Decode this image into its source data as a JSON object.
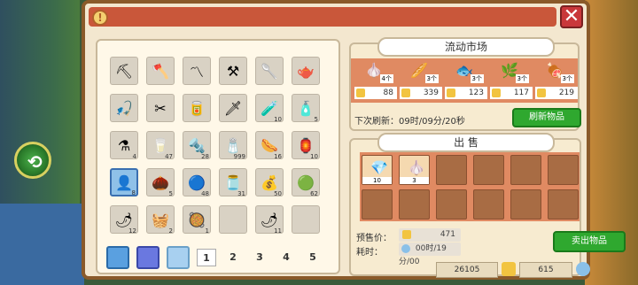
{
  "market": {
    "title": "流动市场",
    "items": [
      {
        "name": "garlic-item",
        "icon": "🧄",
        "stock": "4个",
        "price": "88"
      },
      {
        "name": "bread-item",
        "icon": "🥖",
        "stock": "3个",
        "price": "339"
      },
      {
        "name": "fish-item",
        "icon": "🐟",
        "stock": "3个",
        "price": "123"
      },
      {
        "name": "herb-item",
        "icon": "🌿",
        "stock": "3个",
        "price": "117"
      },
      {
        "name": "meat-item",
        "icon": "🍖",
        "stock": "3个",
        "price": "219"
      }
    ],
    "refresh_text": "下次刷新：09时/09分/20秒",
    "refresh_button": "刷新物品"
  },
  "sell": {
    "title": "出 售",
    "items": [
      {
        "icon": "💎",
        "count": "10"
      },
      {
        "icon": "🧄",
        "count": "3"
      }
    ],
    "presale_label": "预售价：",
    "presale_value": "471",
    "time_label": "耗时：",
    "time_value": "00时/19分/00",
    "sell_button": "卖出物品"
  },
  "inventory": {
    "slots": [
      {
        "icon": "⛏",
        "count": ""
      },
      {
        "icon": "🪓",
        "count": ""
      },
      {
        "icon": "〽",
        "count": ""
      },
      {
        "icon": "⚒",
        "count": ""
      },
      {
        "icon": "🥄",
        "count": ""
      },
      {
        "icon": "🫖",
        "count": ""
      },
      {
        "icon": "🎣",
        "count": ""
      },
      {
        "icon": "✂",
        "count": ""
      },
      {
        "icon": "🥫",
        "count": ""
      },
      {
        "icon": "🗡",
        "count": ""
      },
      {
        "icon": "🧪",
        "count": "10"
      },
      {
        "icon": "🧴",
        "count": "5"
      },
      {
        "icon": "⚗",
        "count": "4"
      },
      {
        "icon": "🥛",
        "count": "47"
      },
      {
        "icon": "🔩",
        "count": "28"
      },
      {
        "icon": "🧂",
        "count": "999"
      },
      {
        "icon": "🌭",
        "count": "16"
      },
      {
        "icon": "🏮",
        "count": "10"
      },
      {
        "icon": "👤",
        "count": "8"
      },
      {
        "icon": "🌰",
        "count": "5"
      },
      {
        "icon": "🔵",
        "count": "48"
      },
      {
        "icon": "🫙",
        "count": "31"
      },
      {
        "icon": "💰",
        "count": "50"
      },
      {
        "icon": "🟢",
        "count": "62"
      },
      {
        "icon": "🌶",
        "count": "12"
      },
      {
        "icon": "🧺",
        "count": "2"
      },
      {
        "icon": "🥘",
        "count": "1"
      },
      {
        "icon": "",
        "count": ""
      },
      {
        "icon": "🌶",
        "count": "11"
      },
      {
        "icon": "",
        "count": ""
      }
    ],
    "pages": [
      "1",
      "2",
      "3",
      "4",
      "5"
    ]
  },
  "footer": {
    "coins": "26105",
    "gems": "615"
  },
  "colors": {
    "accent": "#c9573a",
    "panel": "#f3e7cf",
    "green": "#2fa82f"
  }
}
